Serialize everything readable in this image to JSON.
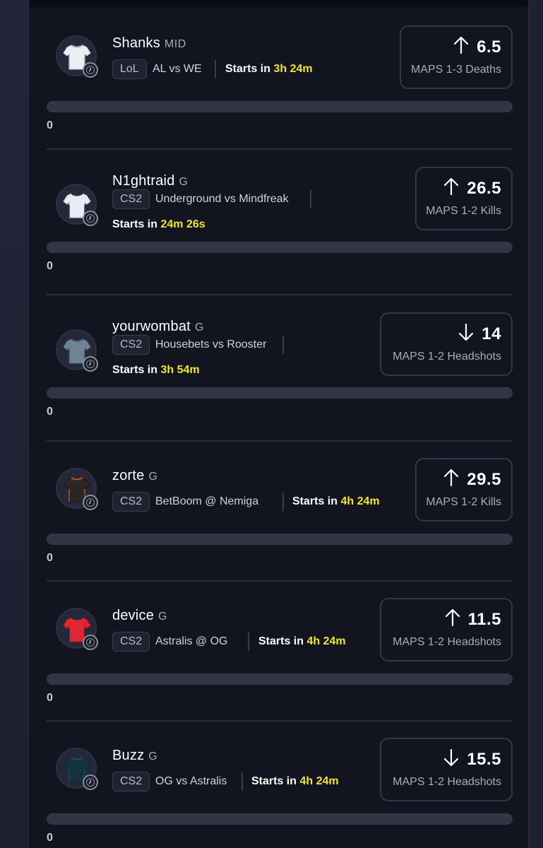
{
  "props": [
    {
      "player": "Shanks",
      "position": "MID",
      "game": "LoL",
      "team1": "AL",
      "connector": "vs",
      "team2": "WE",
      "starts_label": "Starts in",
      "starts_time": "3h 24m",
      "direction": "up",
      "line": "6.5",
      "market": "MAPS 1-3 Deaths",
      "progress": 0,
      "count": "0",
      "shirt": "white"
    },
    {
      "player": "N1ghtraid",
      "position": "G",
      "game": "CS2",
      "team1": "Underground",
      "connector": "vs",
      "team2": "Mindfreak",
      "starts_label": "Starts in",
      "starts_time": "24m 26s",
      "direction": "up",
      "line": "26.5",
      "market": "MAPS 1-2 Kills",
      "progress": 0,
      "count": "0",
      "shirt": "lightblue"
    },
    {
      "player": "yourwombat",
      "position": "G",
      "game": "CS2",
      "team1": "Housebets",
      "connector": "vs",
      "team2": "Rooster",
      "starts_label": "Starts in",
      "starts_time": "3h 54m",
      "direction": "down",
      "line": "14",
      "market": "MAPS 1-2 Headshots",
      "progress": 0,
      "count": "0",
      "shirt": "steel"
    },
    {
      "player": "zorte",
      "position": "G",
      "game": "CS2",
      "team1": "BetBoom",
      "connector": "@",
      "team2": "Nemiga",
      "starts_label": "Starts in",
      "starts_time": "4h 24m",
      "direction": "up",
      "line": "29.5",
      "market": "MAPS 1-2 Kills",
      "progress": 0,
      "count": "0",
      "shirt": "dark"
    },
    {
      "player": "device",
      "position": "G",
      "game": "CS2",
      "team1": "Astralis",
      "connector": "@",
      "team2": "OG",
      "starts_label": "Starts in",
      "starts_time": "4h 24m",
      "direction": "up",
      "line": "11.5",
      "market": "MAPS 1-2 Headshots",
      "progress": 0,
      "count": "0",
      "shirt": "red"
    },
    {
      "player": "Buzz",
      "position": "G",
      "game": "CS2",
      "team1": "OG",
      "connector": "vs",
      "team2": "Astralis",
      "starts_label": "Starts in",
      "starts_time": "4h 24m",
      "direction": "down",
      "line": "15.5",
      "market": "MAPS 1-2 Headshots",
      "progress": 0,
      "count": "0",
      "shirt": "navy"
    }
  ],
  "colors": {
    "accent": "#f1e530",
    "panel": "#121420",
    "track": "#323546"
  },
  "icons": {
    "up": "arrow-up-icon",
    "down": "arrow-down-icon",
    "clock": "clock-icon",
    "shirt": "jersey-icon"
  }
}
